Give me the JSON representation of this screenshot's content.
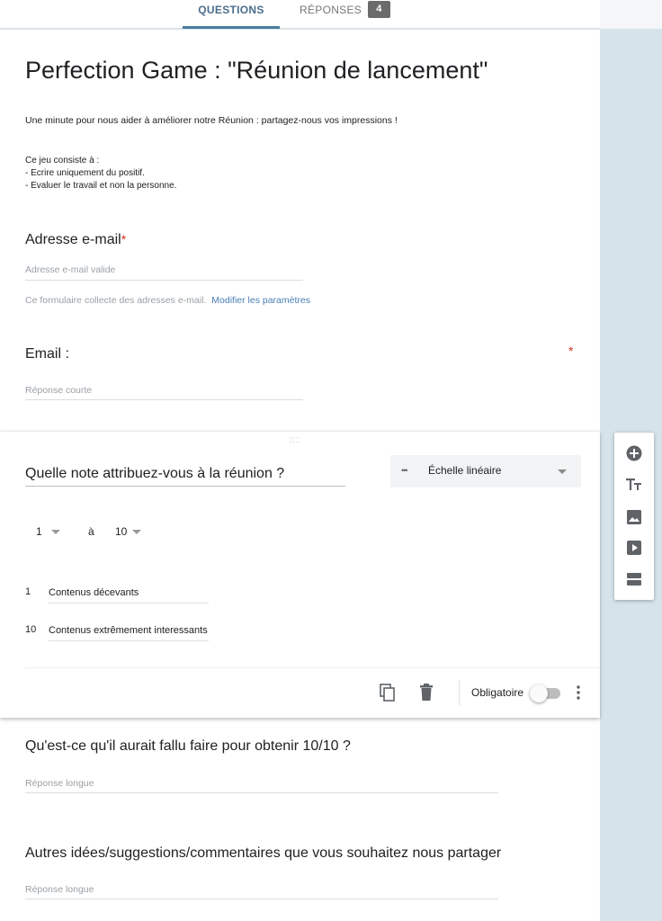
{
  "tabs": {
    "questions": "QUESTIONS",
    "responses": "RÉPONSES",
    "responses_count": "4"
  },
  "form": {
    "title": "Perfection Game : \"Réunion de lancement\"",
    "description": "Une minute pour nous aider à améliorer notre Réunion  : partagez-nous vos impressions !",
    "rules_intro": "Ce jeu consiste à :",
    "rules_1": "- Ecrire uniquement du positif.",
    "rules_2": "- Evaluer le travail et non la personne."
  },
  "email_question": {
    "title": "Adresse e-mail",
    "required_mark": "*",
    "placeholder": "Adresse e-mail valide",
    "note": "Ce formulaire collecte des adresses e-mail.",
    "settings_link": "Modifier les paramètres"
  },
  "q_email": {
    "title": "Email :",
    "required_mark": "*",
    "placeholder": "Réponse courte"
  },
  "active_question": {
    "drag_handle": ":::",
    "title": "Quelle note attribuez-vous à la réunion  ?",
    "type_icon": "•••",
    "type_label": "Échelle linéaire",
    "scale_min": "1",
    "scale_to": "à",
    "scale_max": "10",
    "label_min_num": "1",
    "label_min": "Contenus décevants",
    "label_max_num": "10",
    "label_max": "Contenus extrêmement interessants",
    "required_label": "Obligatoire",
    "required_on": false
  },
  "q_improve": {
    "title": "Qu'est-ce qu'il aurait fallu faire pour obtenir 10/10 ?",
    "placeholder": "Réponse longue"
  },
  "q_other": {
    "title": "Autres idées/suggestions/commentaires que vous souhaitez nous partager",
    "placeholder": "Réponse longue"
  },
  "icons": {
    "footer": [
      "copy-icon",
      "trash-icon",
      "more-vert-icon"
    ],
    "toolbar": [
      "add-circle-icon",
      "text-title-icon",
      "image-icon",
      "video-icon",
      "section-icon"
    ]
  },
  "colors": {
    "accent": "#4a7b9d",
    "required": "#d93025",
    "link": "#4a7fb5",
    "background": "#d6e3ea"
  }
}
